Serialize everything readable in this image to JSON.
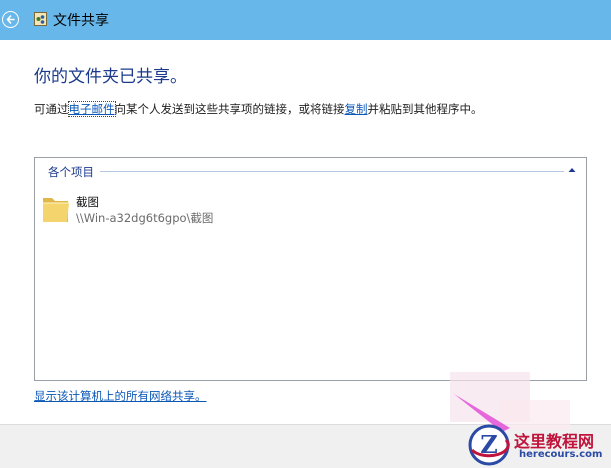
{
  "window": {
    "title": "文件共享"
  },
  "main": {
    "heading": "你的文件夹已共享。",
    "desc_prefix": "可通过",
    "email_link": "电子邮件",
    "desc_middle": "向某个人发送到这些共享项的链接，或将链接",
    "copy_link": "复制",
    "desc_suffix": "并粘贴到其他程序中。"
  },
  "list": {
    "group_title": "各个项目",
    "items": [
      {
        "name": "截图",
        "path": "\\\\Win-a32dg6t6gpo\\截图",
        "icon": "folder-icon"
      }
    ]
  },
  "footer": {
    "show_all_link": "显示该计算机上的所有网络共享。"
  },
  "watermark": {
    "title": "这里教程网",
    "url": "herecours.com",
    "logo_letter": "Z"
  },
  "colors": {
    "titlebar": "#67b7ea",
    "heading": "#1b3a8c",
    "link": "#0a57b8",
    "watermark_red": "#c0143c"
  }
}
